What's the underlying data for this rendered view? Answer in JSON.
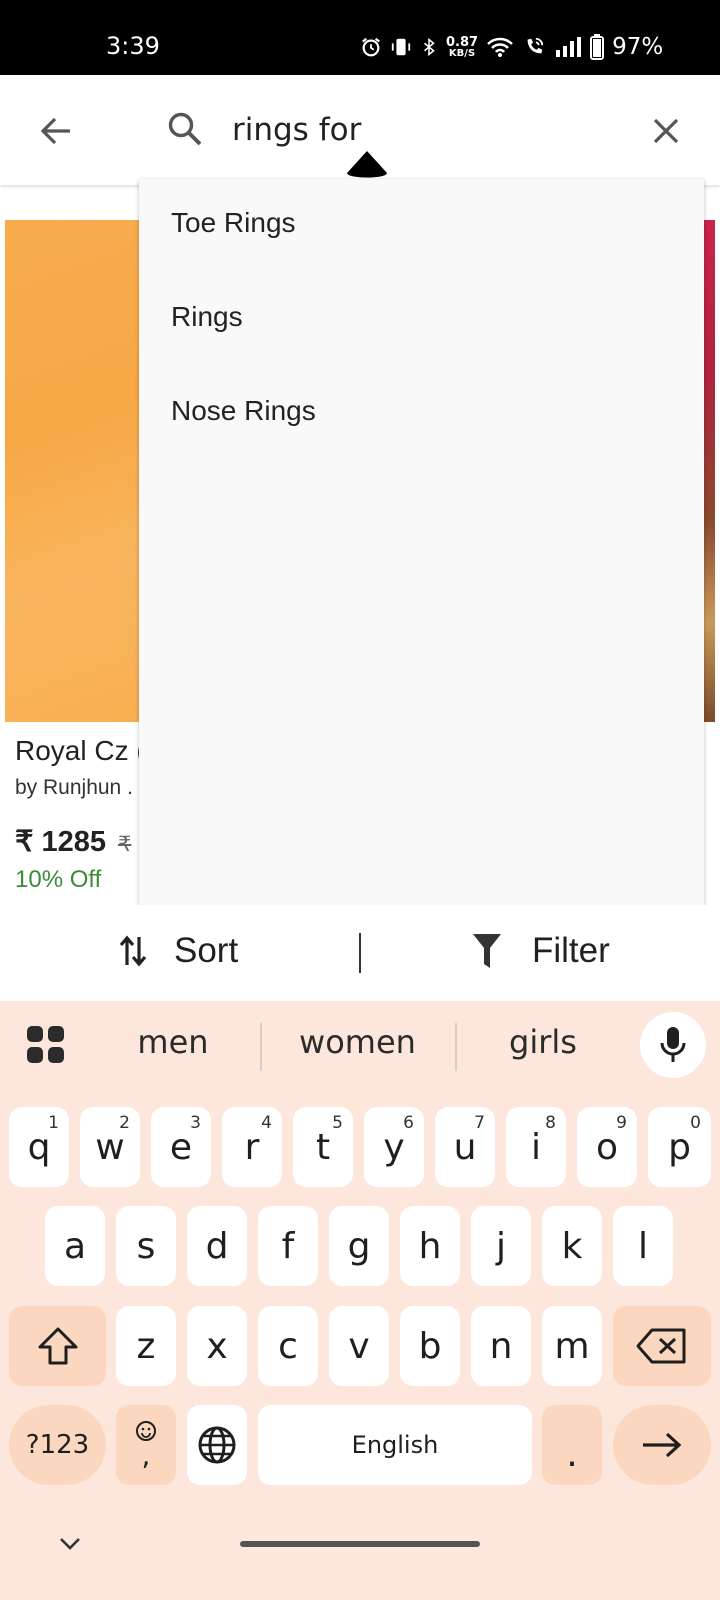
{
  "status_bar": {
    "time": "3:39",
    "net_speed_value": "0.87",
    "net_speed_unit": "KB/S",
    "battery": "97%"
  },
  "search": {
    "query": "rings for"
  },
  "suggestions": [
    {
      "label": "Toe Rings"
    },
    {
      "label": "Rings"
    },
    {
      "label": "Nose Rings"
    }
  ],
  "product": {
    "title": "Royal Cz (",
    "brand": "by Runjhun .",
    "price": "₹ 1285",
    "mrp": "₹",
    "discount": "10% Off"
  },
  "sort_filter": {
    "sort_label": "Sort",
    "filter_label": "Filter"
  },
  "keyboard": {
    "suggestions": [
      "men",
      "women",
      "girls"
    ],
    "row1": [
      {
        "k": "q",
        "h": "1"
      },
      {
        "k": "w",
        "h": "2"
      },
      {
        "k": "e",
        "h": "3"
      },
      {
        "k": "r",
        "h": "4"
      },
      {
        "k": "t",
        "h": "5"
      },
      {
        "k": "y",
        "h": "6"
      },
      {
        "k": "u",
        "h": "7"
      },
      {
        "k": "i",
        "h": "8"
      },
      {
        "k": "o",
        "h": "9"
      },
      {
        "k": "p",
        "h": "0"
      }
    ],
    "row2": [
      "a",
      "s",
      "d",
      "f",
      "g",
      "h",
      "j",
      "k",
      "l"
    ],
    "row3": [
      "z",
      "x",
      "c",
      "v",
      "b",
      "n",
      "m"
    ],
    "symbols_label": "?123",
    "comma_label": ",",
    "space_label": "English",
    "period_label": ".",
    "colors": {
      "background": "#fde7dd",
      "key": "#ffffff",
      "special_key": "#fbd7bf"
    }
  },
  "icons": {
    "back": "arrow-left-icon",
    "search": "search-icon",
    "clear": "close-icon",
    "sort": "sort-arrows-icon",
    "filter": "funnel-icon",
    "mic": "microphone-icon",
    "apps": "grid-apps-icon",
    "shift": "shift-icon",
    "backspace": "backspace-icon",
    "emoji": "emoji-icon",
    "globe": "globe-icon",
    "enter": "arrow-right-icon",
    "hide_keyboard": "chevron-down-icon"
  }
}
